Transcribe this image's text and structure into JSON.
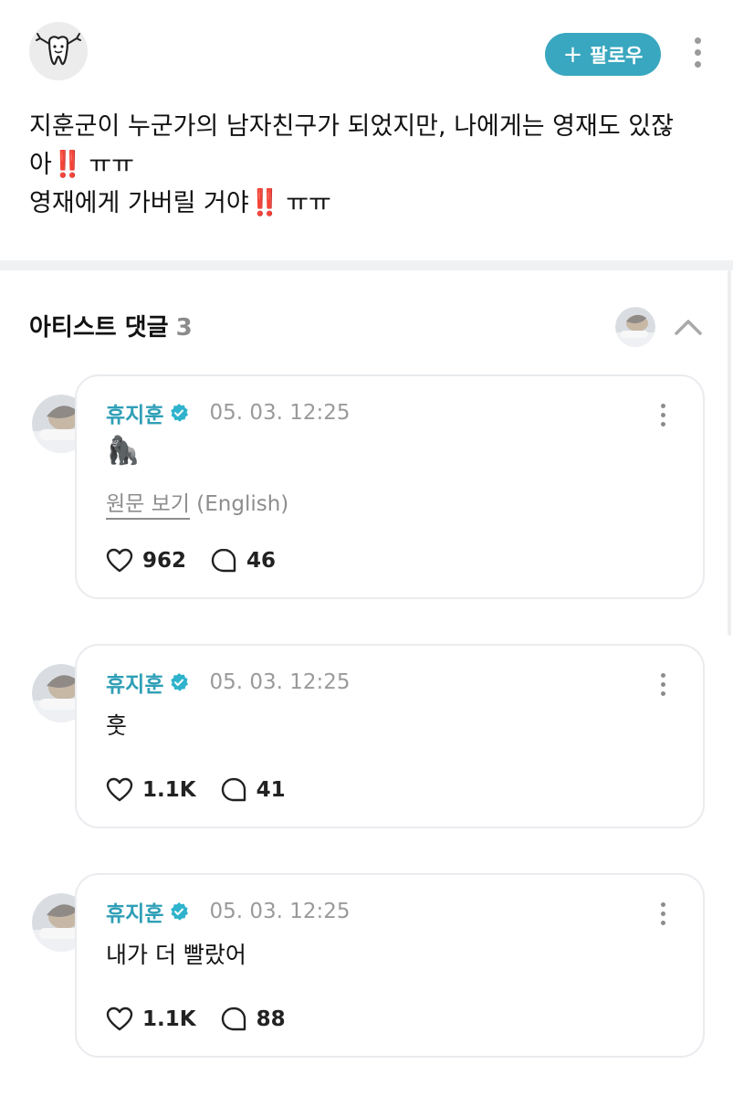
{
  "header": {
    "follow_label": "팔로우",
    "follow_icon": "plus-icon",
    "menu_icon": "kebab-vertical-icon",
    "author_avatar_icon": "tooth-mascot-icon"
  },
  "post": {
    "line1": "지훈군이 누군가의 남자친구가 되었지만, 나에게는 영재도 있잖",
    "line2_text": "아",
    "line2_suffix": "ㅠㅠ",
    "line3_text": "영재에게 가버릴 거야",
    "line3_suffix": "ㅠㅠ",
    "emphasis": "‼️"
  },
  "artist_comments": {
    "title": "아티스트 댓글",
    "count": "3",
    "collapse_icon": "chevron-up-icon"
  },
  "comments": [
    {
      "name": "휴지훈",
      "date": "05. 03. 12:25",
      "text": "🦍",
      "translate_label": "원문 보기",
      "translate_lang": "(English)",
      "likes": "962",
      "replies": "46"
    },
    {
      "name": "휴지훈",
      "date": "05. 03. 12:25",
      "text": "훗",
      "likes": "1.1K",
      "replies": "41"
    },
    {
      "name": "휴지훈",
      "date": "05. 03. 12:25",
      "text": "내가 더 빨랐어",
      "likes": "1.1K",
      "replies": "88"
    }
  ],
  "colors": {
    "accent": "#39a7bf",
    "name": "#2f9fb7",
    "exclamation": "#e0231d",
    "card_border": "#e9ebee"
  }
}
